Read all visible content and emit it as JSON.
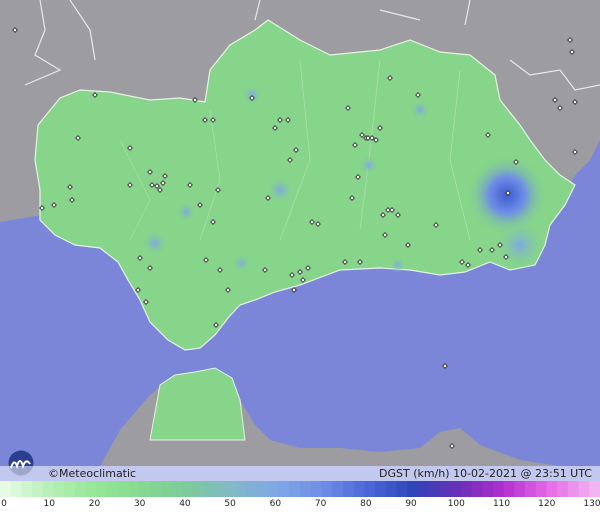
{
  "brand": {
    "copyright_label": "©Meteoclimatic"
  },
  "header": {
    "variable": "DGST (km/h)",
    "date": "10-02-2021",
    "time": "23:51 UTC",
    "title_text": "DGST (km/h)  10-02-2021 @ 23:51 UTC"
  },
  "legend": {
    "unit": "km/h",
    "ticks": [
      "0",
      "10",
      "20",
      "30",
      "40",
      "50",
      "60",
      "70",
      "80",
      "90",
      "100",
      "110",
      "120",
      "130"
    ],
    "min": 0,
    "max": 130,
    "colors": [
      "#e6fbe6",
      "#b4f0b4",
      "#96e696",
      "#86d990",
      "#7dca9a",
      "#82b8c8",
      "#7ea8e6",
      "#6f8ee6",
      "#4a66d8",
      "#2e45b8",
      "#6a2fb8",
      "#b42fd0",
      "#e66be6",
      "#f2b4f2"
    ]
  },
  "map_colors": {
    "sea": "#7b86d9",
    "land_outside": "#9a9a9e",
    "region": "#86d58a",
    "gust_high": "#6f8ee6"
  }
}
